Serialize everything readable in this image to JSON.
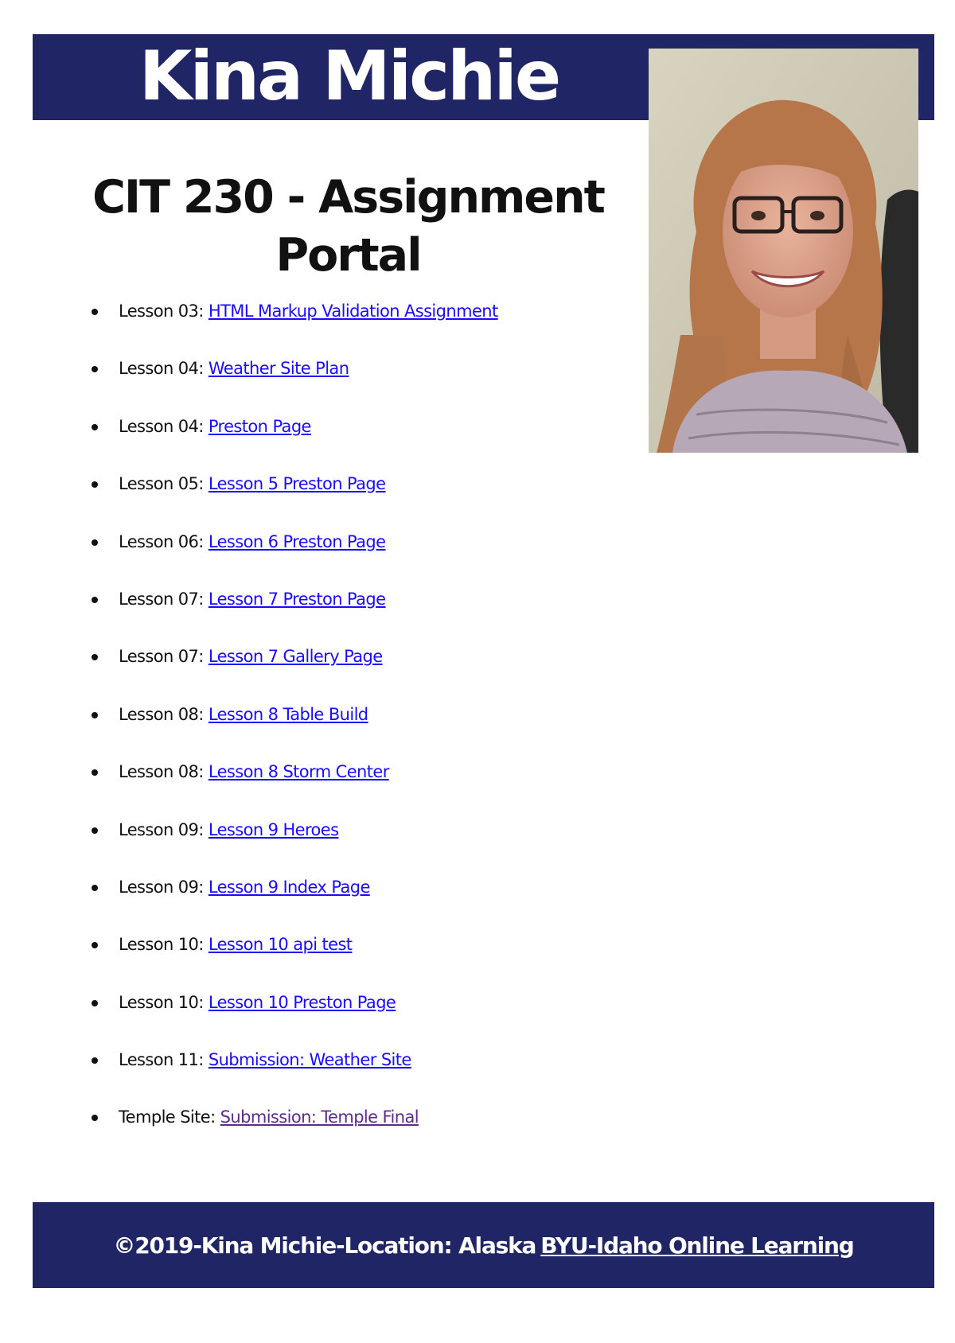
{
  "header": {
    "title": "Kina Michie"
  },
  "page": {
    "heading": "CIT 230 - Assignment Portal"
  },
  "lessons": [
    {
      "prefix": "Lesson 03:",
      "link": "HTML Markup Validation Assignment"
    },
    {
      "prefix": "Lesson 04:",
      "link": "Weather Site Plan"
    },
    {
      "prefix": "Lesson 04:",
      "link": "Preston Page"
    },
    {
      "prefix": "Lesson 05:",
      "link": "Lesson 5 Preston Page"
    },
    {
      "prefix": "Lesson 06:",
      "link": "Lesson 6 Preston Page"
    },
    {
      "prefix": "Lesson 07:",
      "link": "Lesson 7 Preston Page"
    },
    {
      "prefix": "Lesson 07:",
      "link": "Lesson 7 Gallery Page"
    },
    {
      "prefix": "Lesson 08:",
      "link": "Lesson 8 Table Build"
    },
    {
      "prefix": "Lesson 08:",
      "link": "Lesson 8 Storm Center"
    },
    {
      "prefix": "Lesson 09:",
      "link": "Lesson 9 Heroes"
    },
    {
      "prefix": "Lesson 09:",
      "link": "Lesson 9 Index Page"
    },
    {
      "prefix": "Lesson 10:",
      "link": "Lesson 10 api test"
    },
    {
      "prefix": "Lesson 10:",
      "link": "Lesson 10 Preston Page"
    },
    {
      "prefix": "Lesson 11:",
      "link": "Submission: Weather Site"
    },
    {
      "prefix": "Temple Site:",
      "link": "Submission: Temple Final"
    }
  ],
  "footer": {
    "text": "©2019-Kina Michie-Location: Alaska",
    "link": "BYU-Idaho Online Learning"
  },
  "colors": {
    "banner": "#202566",
    "link": "#1a0dff",
    "visited_link": "#5e2b8f"
  }
}
